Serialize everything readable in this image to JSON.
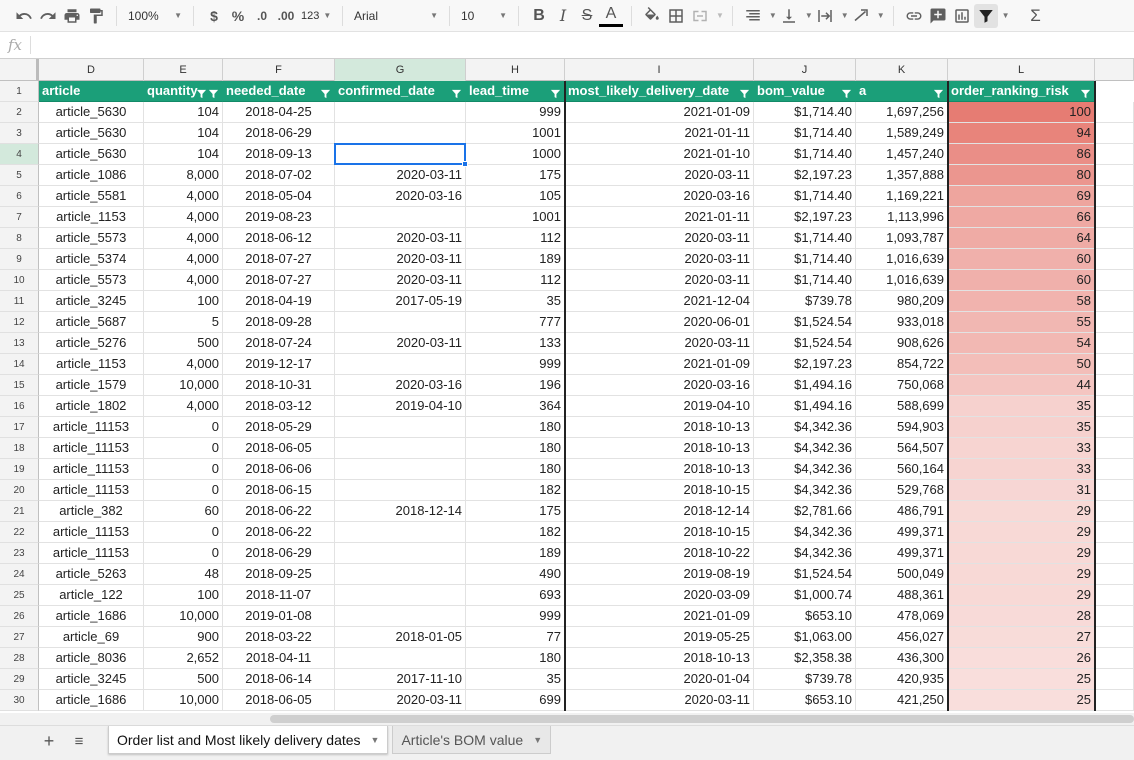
{
  "toolbar": {
    "zoom": "100%",
    "currency": "$",
    "percent": "%",
    "dec_less": ".0",
    "dec_more": ".00",
    "format_more": "123",
    "font": "Arial",
    "font_size": "10"
  },
  "formula_bar": {
    "fx_label": "fx",
    "value": ""
  },
  "columns": [
    {
      "letter": "D",
      "header": "article"
    },
    {
      "letter": "E",
      "header": "quantity"
    },
    {
      "letter": "F",
      "header": "needed_date"
    },
    {
      "letter": "G",
      "header": "confirmed_date"
    },
    {
      "letter": "H",
      "header": "lead_time"
    },
    {
      "letter": "I",
      "header": "most_likely_delivery_date"
    },
    {
      "letter": "J",
      "header": "bom_value"
    },
    {
      "letter": "K",
      "header": "a"
    },
    {
      "letter": "L",
      "header": "order_ranking_risk"
    }
  ],
  "selected_cell": "G4",
  "rows": [
    {
      "n": "2",
      "cells": [
        "article_5630",
        "104",
        "2018-04-25",
        "",
        "999",
        "2021-01-09",
        "$1,714.40",
        "1,697,256",
        "100"
      ]
    },
    {
      "n": "3",
      "cells": [
        "article_5630",
        "104",
        "2018-06-29",
        "",
        "1001",
        "2021-01-11",
        "$1,714.40",
        "1,589,249",
        "94"
      ]
    },
    {
      "n": "4",
      "cells": [
        "article_5630",
        "104",
        "2018-09-13",
        "",
        "1000",
        "2021-01-10",
        "$1,714.40",
        "1,457,240",
        "86"
      ]
    },
    {
      "n": "5",
      "cells": [
        "article_1086",
        "8,000",
        "2018-07-02",
        "2020-03-11",
        "175",
        "2020-03-11",
        "$2,197.23",
        "1,357,888",
        "80"
      ]
    },
    {
      "n": "6",
      "cells": [
        "article_5581",
        "4,000",
        "2018-05-04",
        "2020-03-16",
        "105",
        "2020-03-16",
        "$1,714.40",
        "1,169,221",
        "69"
      ]
    },
    {
      "n": "7",
      "cells": [
        "article_1153",
        "4,000",
        "2019-08-23",
        "",
        "1001",
        "2021-01-11",
        "$2,197.23",
        "1,113,996",
        "66"
      ]
    },
    {
      "n": "8",
      "cells": [
        "article_5573",
        "4,000",
        "2018-06-12",
        "2020-03-11",
        "112",
        "2020-03-11",
        "$1,714.40",
        "1,093,787",
        "64"
      ]
    },
    {
      "n": "9",
      "cells": [
        "article_5374",
        "4,000",
        "2018-07-27",
        "2020-03-11",
        "189",
        "2020-03-11",
        "$1,714.40",
        "1,016,639",
        "60"
      ]
    },
    {
      "n": "10",
      "cells": [
        "article_5573",
        "4,000",
        "2018-07-27",
        "2020-03-11",
        "112",
        "2020-03-11",
        "$1,714.40",
        "1,016,639",
        "60"
      ]
    },
    {
      "n": "11",
      "cells": [
        "article_3245",
        "100",
        "2018-04-19",
        "2017-05-19",
        "35",
        "2021-12-04",
        "$739.78",
        "980,209",
        "58"
      ]
    },
    {
      "n": "12",
      "cells": [
        "article_5687",
        "5",
        "2018-09-28",
        "",
        "777",
        "2020-06-01",
        "$1,524.54",
        "933,018",
        "55"
      ]
    },
    {
      "n": "13",
      "cells": [
        "article_5276",
        "500",
        "2018-07-24",
        "2020-03-11",
        "133",
        "2020-03-11",
        "$1,524.54",
        "908,626",
        "54"
      ]
    },
    {
      "n": "14",
      "cells": [
        "article_1153",
        "4,000",
        "2019-12-17",
        "",
        "999",
        "2021-01-09",
        "$2,197.23",
        "854,722",
        "50"
      ]
    },
    {
      "n": "15",
      "cells": [
        "article_1579",
        "10,000",
        "2018-10-31",
        "2020-03-16",
        "196",
        "2020-03-16",
        "$1,494.16",
        "750,068",
        "44"
      ]
    },
    {
      "n": "16",
      "cells": [
        "article_1802",
        "4,000",
        "2018-03-12",
        "2019-04-10",
        "364",
        "2019-04-10",
        "$1,494.16",
        "588,699",
        "35"
      ]
    },
    {
      "n": "17",
      "cells": [
        "article_11153",
        "0",
        "2018-05-29",
        "",
        "180",
        "2018-10-13",
        "$4,342.36",
        "594,903",
        "35"
      ]
    },
    {
      "n": "18",
      "cells": [
        "article_11153",
        "0",
        "2018-06-05",
        "",
        "180",
        "2018-10-13",
        "$4,342.36",
        "564,507",
        "33"
      ]
    },
    {
      "n": "19",
      "cells": [
        "article_11153",
        "0",
        "2018-06-06",
        "",
        "180",
        "2018-10-13",
        "$4,342.36",
        "560,164",
        "33"
      ]
    },
    {
      "n": "20",
      "cells": [
        "article_11153",
        "0",
        "2018-06-15",
        "",
        "182",
        "2018-10-15",
        "$4,342.36",
        "529,768",
        "31"
      ]
    },
    {
      "n": "21",
      "cells": [
        "article_382",
        "60",
        "2018-06-22",
        "2018-12-14",
        "175",
        "2018-12-14",
        "$2,781.66",
        "486,791",
        "29"
      ]
    },
    {
      "n": "22",
      "cells": [
        "article_11153",
        "0",
        "2018-06-22",
        "",
        "182",
        "2018-10-15",
        "$4,342.36",
        "499,371",
        "29"
      ]
    },
    {
      "n": "23",
      "cells": [
        "article_11153",
        "0",
        "2018-06-29",
        "",
        "189",
        "2018-10-22",
        "$4,342.36",
        "499,371",
        "29"
      ]
    },
    {
      "n": "24",
      "cells": [
        "article_5263",
        "48",
        "2018-09-25",
        "",
        "490",
        "2019-08-19",
        "$1,524.54",
        "500,049",
        "29"
      ]
    },
    {
      "n": "25",
      "cells": [
        "article_122",
        "100",
        "2018-11-07",
        "",
        "693",
        "2020-03-09",
        "$1,000.74",
        "488,361",
        "29"
      ]
    },
    {
      "n": "26",
      "cells": [
        "article_1686",
        "10,000",
        "2019-01-08",
        "",
        "999",
        "2021-01-09",
        "$653.10",
        "478,069",
        "28"
      ]
    },
    {
      "n": "27",
      "cells": [
        "article_69",
        "900",
        "2018-03-22",
        "2018-01-05",
        "77",
        "2019-05-25",
        "$1,063.00",
        "456,027",
        "27"
      ]
    },
    {
      "n": "28",
      "cells": [
        "article_8036",
        "2,652",
        "2018-04-11",
        "",
        "180",
        "2018-10-13",
        "$2,358.38",
        "436,300",
        "26"
      ]
    },
    {
      "n": "29",
      "cells": [
        "article_3245",
        "500",
        "2018-06-14",
        "2017-11-10",
        "35",
        "2020-01-04",
        "$739.78",
        "420,935",
        "25"
      ]
    },
    {
      "n": "30",
      "cells": [
        "article_1686",
        "10,000",
        "2018-06-05",
        "2020-03-11",
        "699",
        "2020-03-11",
        "$653.10",
        "421,250",
        "25"
      ]
    }
  ],
  "colors": {
    "header_bg": "#1b9f79",
    "risk_high": "#e67c73",
    "risk_low": "#ffffff",
    "selection": "#1a73e8",
    "selected_header": "#d3e9dc"
  },
  "tabs": [
    {
      "label": "Order list and Most likely delivery dates",
      "active": true
    },
    {
      "label": "Article's BOM value",
      "active": false
    }
  ]
}
